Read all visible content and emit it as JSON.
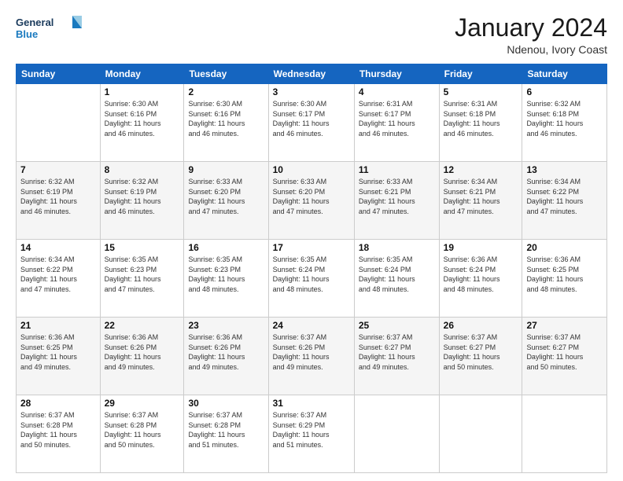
{
  "logo": {
    "line1": "General",
    "line2": "Blue"
  },
  "header": {
    "month": "January 2024",
    "location": "Ndenou, Ivory Coast"
  },
  "weekdays": [
    "Sunday",
    "Monday",
    "Tuesday",
    "Wednesday",
    "Thursday",
    "Friday",
    "Saturday"
  ],
  "weeks": [
    [
      {
        "day": "",
        "info": ""
      },
      {
        "day": "1",
        "info": "Sunrise: 6:30 AM\nSunset: 6:16 PM\nDaylight: 11 hours\nand 46 minutes."
      },
      {
        "day": "2",
        "info": "Sunrise: 6:30 AM\nSunset: 6:16 PM\nDaylight: 11 hours\nand 46 minutes."
      },
      {
        "day": "3",
        "info": "Sunrise: 6:30 AM\nSunset: 6:17 PM\nDaylight: 11 hours\nand 46 minutes."
      },
      {
        "day": "4",
        "info": "Sunrise: 6:31 AM\nSunset: 6:17 PM\nDaylight: 11 hours\nand 46 minutes."
      },
      {
        "day": "5",
        "info": "Sunrise: 6:31 AM\nSunset: 6:18 PM\nDaylight: 11 hours\nand 46 minutes."
      },
      {
        "day": "6",
        "info": "Sunrise: 6:32 AM\nSunset: 6:18 PM\nDaylight: 11 hours\nand 46 minutes."
      }
    ],
    [
      {
        "day": "7",
        "info": "Sunrise: 6:32 AM\nSunset: 6:19 PM\nDaylight: 11 hours\nand 46 minutes."
      },
      {
        "day": "8",
        "info": "Sunrise: 6:32 AM\nSunset: 6:19 PM\nDaylight: 11 hours\nand 46 minutes."
      },
      {
        "day": "9",
        "info": "Sunrise: 6:33 AM\nSunset: 6:20 PM\nDaylight: 11 hours\nand 47 minutes."
      },
      {
        "day": "10",
        "info": "Sunrise: 6:33 AM\nSunset: 6:20 PM\nDaylight: 11 hours\nand 47 minutes."
      },
      {
        "day": "11",
        "info": "Sunrise: 6:33 AM\nSunset: 6:21 PM\nDaylight: 11 hours\nand 47 minutes."
      },
      {
        "day": "12",
        "info": "Sunrise: 6:34 AM\nSunset: 6:21 PM\nDaylight: 11 hours\nand 47 minutes."
      },
      {
        "day": "13",
        "info": "Sunrise: 6:34 AM\nSunset: 6:22 PM\nDaylight: 11 hours\nand 47 minutes."
      }
    ],
    [
      {
        "day": "14",
        "info": "Sunrise: 6:34 AM\nSunset: 6:22 PM\nDaylight: 11 hours\nand 47 minutes."
      },
      {
        "day": "15",
        "info": "Sunrise: 6:35 AM\nSunset: 6:23 PM\nDaylight: 11 hours\nand 47 minutes."
      },
      {
        "day": "16",
        "info": "Sunrise: 6:35 AM\nSunset: 6:23 PM\nDaylight: 11 hours\nand 48 minutes."
      },
      {
        "day": "17",
        "info": "Sunrise: 6:35 AM\nSunset: 6:24 PM\nDaylight: 11 hours\nand 48 minutes."
      },
      {
        "day": "18",
        "info": "Sunrise: 6:35 AM\nSunset: 6:24 PM\nDaylight: 11 hours\nand 48 minutes."
      },
      {
        "day": "19",
        "info": "Sunrise: 6:36 AM\nSunset: 6:24 PM\nDaylight: 11 hours\nand 48 minutes."
      },
      {
        "day": "20",
        "info": "Sunrise: 6:36 AM\nSunset: 6:25 PM\nDaylight: 11 hours\nand 48 minutes."
      }
    ],
    [
      {
        "day": "21",
        "info": "Sunrise: 6:36 AM\nSunset: 6:25 PM\nDaylight: 11 hours\nand 49 minutes."
      },
      {
        "day": "22",
        "info": "Sunrise: 6:36 AM\nSunset: 6:26 PM\nDaylight: 11 hours\nand 49 minutes."
      },
      {
        "day": "23",
        "info": "Sunrise: 6:36 AM\nSunset: 6:26 PM\nDaylight: 11 hours\nand 49 minutes."
      },
      {
        "day": "24",
        "info": "Sunrise: 6:37 AM\nSunset: 6:26 PM\nDaylight: 11 hours\nand 49 minutes."
      },
      {
        "day": "25",
        "info": "Sunrise: 6:37 AM\nSunset: 6:27 PM\nDaylight: 11 hours\nand 49 minutes."
      },
      {
        "day": "26",
        "info": "Sunrise: 6:37 AM\nSunset: 6:27 PM\nDaylight: 11 hours\nand 50 minutes."
      },
      {
        "day": "27",
        "info": "Sunrise: 6:37 AM\nSunset: 6:27 PM\nDaylight: 11 hours\nand 50 minutes."
      }
    ],
    [
      {
        "day": "28",
        "info": "Sunrise: 6:37 AM\nSunset: 6:28 PM\nDaylight: 11 hours\nand 50 minutes."
      },
      {
        "day": "29",
        "info": "Sunrise: 6:37 AM\nSunset: 6:28 PM\nDaylight: 11 hours\nand 50 minutes."
      },
      {
        "day": "30",
        "info": "Sunrise: 6:37 AM\nSunset: 6:28 PM\nDaylight: 11 hours\nand 51 minutes."
      },
      {
        "day": "31",
        "info": "Sunrise: 6:37 AM\nSunset: 6:29 PM\nDaylight: 11 hours\nand 51 minutes."
      },
      {
        "day": "",
        "info": ""
      },
      {
        "day": "",
        "info": ""
      },
      {
        "day": "",
        "info": ""
      }
    ]
  ]
}
